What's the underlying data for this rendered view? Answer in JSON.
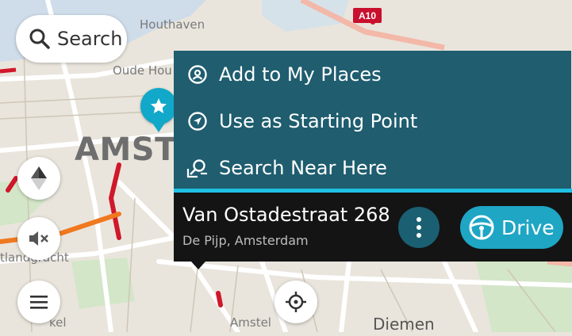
{
  "map": {
    "city_label": "AMSTE",
    "labels": {
      "houthaven": "Houthaven",
      "oude_houthaven": "Oude Hou",
      "westergracht": "tlandgracht",
      "amstel": "Amstel",
      "diemen": "Diemen",
      "bottom_left": "kel"
    },
    "road_badge": "A10"
  },
  "search": {
    "label": "Search",
    "icon": "search-icon"
  },
  "menu": {
    "items": [
      {
        "label": "Add to My Places",
        "icon": "place-pin-icon"
      },
      {
        "label": "Use as Starting Point",
        "icon": "navigation-arrow-icon"
      },
      {
        "label": "Search Near Here",
        "icon": "search-near-icon"
      }
    ]
  },
  "location": {
    "address": "Van Ostadestraat 268",
    "area": "De Pijp, Amsterdam",
    "drive_label": "Drive"
  },
  "colors": {
    "menu_bg": "#1f5d6f",
    "accent": "#1ec1e3",
    "drive": "#1ea6c4",
    "panel_bg": "#141414",
    "traffic": "#d0182a"
  }
}
